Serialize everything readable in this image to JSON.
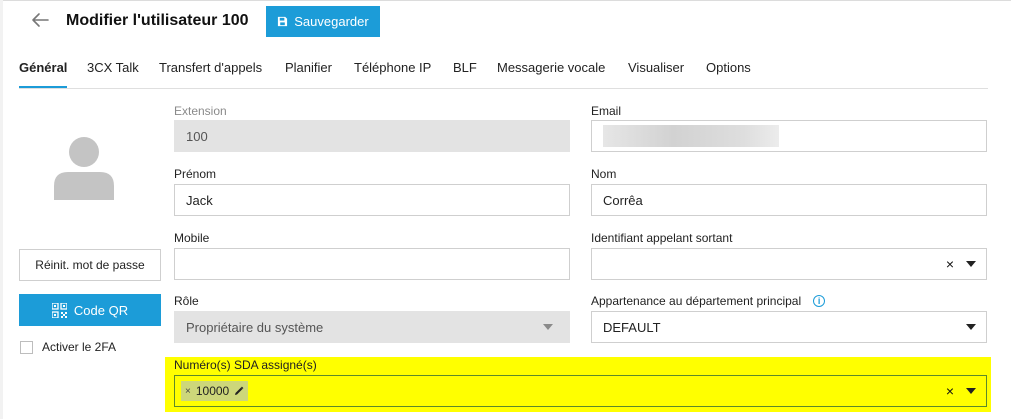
{
  "header": {
    "title": "Modifier l'utilisateur 100",
    "save_label": "Sauvegarder"
  },
  "tabs": [
    {
      "label": "Général",
      "active": true
    },
    {
      "label": "3CX Talk"
    },
    {
      "label": "Transfert d'appels"
    },
    {
      "label": "Planifier"
    },
    {
      "label": "Téléphone IP"
    },
    {
      "label": "BLF"
    },
    {
      "label": "Messagerie vocale"
    },
    {
      "label": "Visualiser"
    },
    {
      "label": "Options"
    }
  ],
  "sidebar": {
    "reset_password_label": "Réinit. mot de passe",
    "qr_label": "Code QR",
    "twofa_label": "Activer le 2FA",
    "twofa_checked": false
  },
  "form": {
    "extension": {
      "label": "Extension",
      "value": "100"
    },
    "email": {
      "label": "Email",
      "value": ""
    },
    "first_name": {
      "label": "Prénom",
      "value": "Jack"
    },
    "last_name": {
      "label": "Nom",
      "value": "Corrêa"
    },
    "mobile": {
      "label": "Mobile",
      "value": ""
    },
    "outbound_caller_id": {
      "label": "Identifiant appelant sortant",
      "value": ""
    },
    "role": {
      "label": "Rôle",
      "value": "Propriétaire du système"
    },
    "department": {
      "label": "Appartenance au département principal",
      "value": "DEFAULT"
    },
    "did": {
      "label": "Numéro(s) SDA assigné(s)",
      "chips": [
        "10000"
      ]
    }
  },
  "icons": {
    "clear": "×",
    "info": "i"
  },
  "colors": {
    "accent": "#1c9cd8",
    "highlight": "#ffff00",
    "chip": "#cdd77a",
    "disabled_field": "#e3e3e3"
  }
}
